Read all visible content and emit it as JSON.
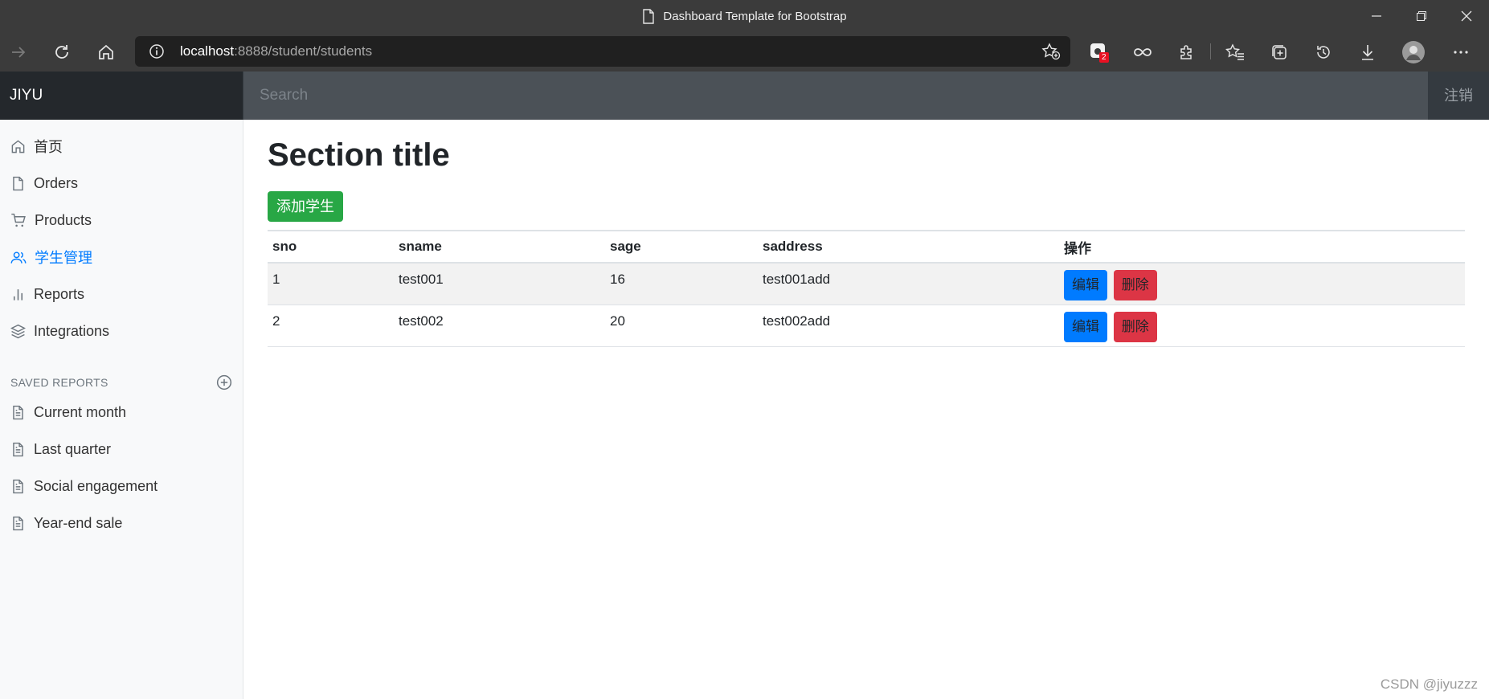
{
  "browser": {
    "tab_title": "Dashboard Template for Bootstrap",
    "address_host": "localhost",
    "address_path": ":8888/student/students",
    "extension_badge": "2"
  },
  "navbar": {
    "brand": "JIYU",
    "search_placeholder": "Search",
    "logout_label": "注销"
  },
  "sidebar": {
    "items": [
      {
        "label": "首页",
        "icon": "home-icon"
      },
      {
        "label": "Orders",
        "icon": "file-icon"
      },
      {
        "label": "Products",
        "icon": "shopping-cart-icon"
      },
      {
        "label": "学生管理",
        "icon": "users-icon",
        "active": true
      },
      {
        "label": "Reports",
        "icon": "bar-chart-icon"
      },
      {
        "label": "Integrations",
        "icon": "layers-icon"
      }
    ],
    "saved_reports_heading": "SAVED REPORTS",
    "saved_reports": [
      {
        "label": "Current month",
        "icon": "file-text-icon"
      },
      {
        "label": "Last quarter",
        "icon": "file-text-icon"
      },
      {
        "label": "Social engagement",
        "icon": "file-text-icon"
      },
      {
        "label": "Year-end sale",
        "icon": "file-text-icon"
      }
    ]
  },
  "main": {
    "title": "Section title",
    "add_button": "添加学生",
    "table": {
      "headers": [
        "sno",
        "sname",
        "sage",
        "saddress",
        "操作"
      ],
      "rows": [
        {
          "sno": "1",
          "sname": "test001",
          "sage": "16",
          "saddress": "test001add"
        },
        {
          "sno": "2",
          "sname": "test002",
          "sage": "20",
          "saddress": "test002add"
        }
      ],
      "edit_label": "编辑",
      "delete_label": "删除"
    }
  },
  "watermark": "CSDN @jiyuzzz",
  "colors": {
    "primary": "#007bff",
    "success": "#28a745",
    "danger": "#dc3545",
    "navbar": "#343a40"
  }
}
